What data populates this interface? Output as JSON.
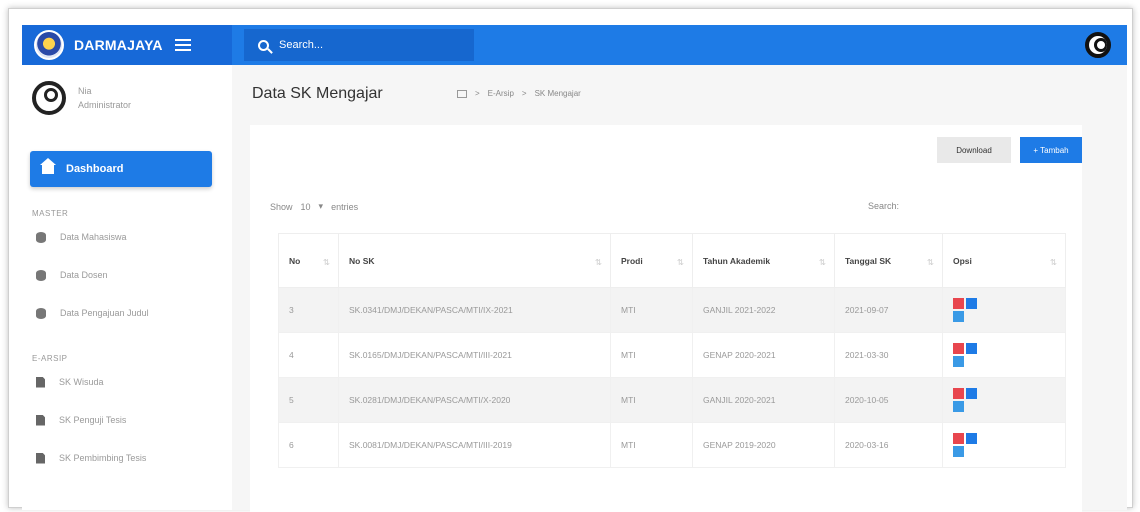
{
  "brand": {
    "name": "DARMAJAYA"
  },
  "search": {
    "placeholder": "Search..."
  },
  "profile": {
    "name": "Nia",
    "role": "Administrator"
  },
  "sidebar": {
    "active": "Dashboard",
    "sections": [
      {
        "title": "MASTER",
        "items": [
          "Data Mahasiswa",
          "Data Dosen",
          "Data Pengajuan Judul"
        ]
      },
      {
        "title": "E-ARSIP",
        "items": [
          "SK Wisuda",
          "SK Penguji Tesis",
          "SK Pembimbing Tesis"
        ]
      }
    ]
  },
  "page": {
    "title": "Data SK Mengajar",
    "breadcrumb": [
      "E-Arsip",
      "SK Mengajar"
    ]
  },
  "toolbar": {
    "download_label": "Download",
    "add_label": "+ Tambah"
  },
  "table": {
    "show_label": "Show",
    "entries_value": "10",
    "entries_label": "entries",
    "search_label": "Search:",
    "columns": [
      "No",
      "No SK",
      "Prodi",
      "Tahun Akademik",
      "Tanggal SK",
      "Opsi"
    ],
    "rows": [
      {
        "no": "3",
        "no_sk": "SK.0341/DMJ/DEKAN/PASCA/MTI/IX-2021",
        "prodi": "MTI",
        "tahun": "GANJIL 2021-2022",
        "tanggal": "2021-09-07"
      },
      {
        "no": "4",
        "no_sk": "SK.0165/DMJ/DEKAN/PASCA/MTI/III-2021",
        "prodi": "MTI",
        "tahun": "GENAP 2020-2021",
        "tanggal": "2021-03-30"
      },
      {
        "no": "5",
        "no_sk": "SK.0281/DMJ/DEKAN/PASCA/MTI/X-2020",
        "prodi": "MTI",
        "tahun": "GANJIL 2020-2021",
        "tanggal": "2020-10-05"
      },
      {
        "no": "6",
        "no_sk": "SK.0081/DMJ/DEKAN/PASCA/MTI/III-2019",
        "prodi": "MTI",
        "tahun": "GENAP 2019-2020",
        "tanggal": "2020-03-16"
      }
    ]
  },
  "colors": {
    "primary": "#1e7be6",
    "danger": "#e8464e"
  }
}
